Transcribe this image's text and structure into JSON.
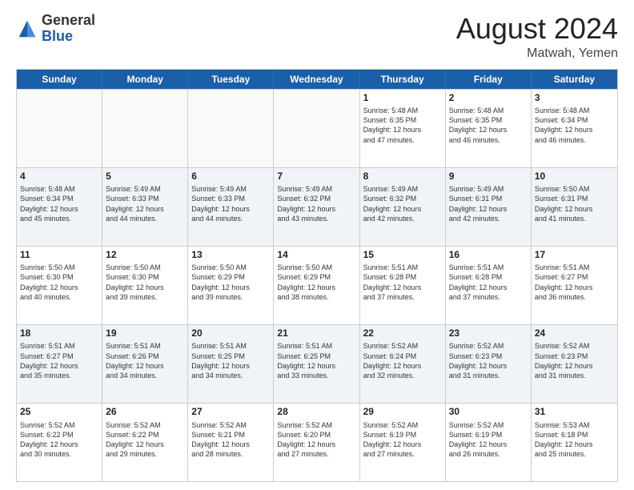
{
  "logo": {
    "general": "General",
    "blue": "Blue"
  },
  "header": {
    "title": "August 2024",
    "subtitle": "Matwah, Yemen"
  },
  "days": [
    "Sunday",
    "Monday",
    "Tuesday",
    "Wednesday",
    "Thursday",
    "Friday",
    "Saturday"
  ],
  "rows": [
    [
      {
        "day": "",
        "text": "",
        "empty": true
      },
      {
        "day": "",
        "text": "",
        "empty": true
      },
      {
        "day": "",
        "text": "",
        "empty": true
      },
      {
        "day": "",
        "text": "",
        "empty": true
      },
      {
        "day": "1",
        "text": "Sunrise: 5:48 AM\nSunset: 6:35 PM\nDaylight: 12 hours\nand 47 minutes.",
        "empty": false
      },
      {
        "day": "2",
        "text": "Sunrise: 5:48 AM\nSunset: 6:35 PM\nDaylight: 12 hours\nand 46 minutes.",
        "empty": false
      },
      {
        "day": "3",
        "text": "Sunrise: 5:48 AM\nSunset: 6:34 PM\nDaylight: 12 hours\nand 46 minutes.",
        "empty": false
      }
    ],
    [
      {
        "day": "4",
        "text": "Sunrise: 5:48 AM\nSunset: 6:34 PM\nDaylight: 12 hours\nand 45 minutes.",
        "empty": false
      },
      {
        "day": "5",
        "text": "Sunrise: 5:49 AM\nSunset: 6:33 PM\nDaylight: 12 hours\nand 44 minutes.",
        "empty": false
      },
      {
        "day": "6",
        "text": "Sunrise: 5:49 AM\nSunset: 6:33 PM\nDaylight: 12 hours\nand 44 minutes.",
        "empty": false
      },
      {
        "day": "7",
        "text": "Sunrise: 5:49 AM\nSunset: 6:32 PM\nDaylight: 12 hours\nand 43 minutes.",
        "empty": false
      },
      {
        "day": "8",
        "text": "Sunrise: 5:49 AM\nSunset: 6:32 PM\nDaylight: 12 hours\nand 42 minutes.",
        "empty": false
      },
      {
        "day": "9",
        "text": "Sunrise: 5:49 AM\nSunset: 6:31 PM\nDaylight: 12 hours\nand 42 minutes.",
        "empty": false
      },
      {
        "day": "10",
        "text": "Sunrise: 5:50 AM\nSunset: 6:31 PM\nDaylight: 12 hours\nand 41 minutes.",
        "empty": false
      }
    ],
    [
      {
        "day": "11",
        "text": "Sunrise: 5:50 AM\nSunset: 6:30 PM\nDaylight: 12 hours\nand 40 minutes.",
        "empty": false
      },
      {
        "day": "12",
        "text": "Sunrise: 5:50 AM\nSunset: 6:30 PM\nDaylight: 12 hours\nand 39 minutes.",
        "empty": false
      },
      {
        "day": "13",
        "text": "Sunrise: 5:50 AM\nSunset: 6:29 PM\nDaylight: 12 hours\nand 39 minutes.",
        "empty": false
      },
      {
        "day": "14",
        "text": "Sunrise: 5:50 AM\nSunset: 6:29 PM\nDaylight: 12 hours\nand 38 minutes.",
        "empty": false
      },
      {
        "day": "15",
        "text": "Sunrise: 5:51 AM\nSunset: 6:28 PM\nDaylight: 12 hours\nand 37 minutes.",
        "empty": false
      },
      {
        "day": "16",
        "text": "Sunrise: 5:51 AM\nSunset: 6:28 PM\nDaylight: 12 hours\nand 37 minutes.",
        "empty": false
      },
      {
        "day": "17",
        "text": "Sunrise: 5:51 AM\nSunset: 6:27 PM\nDaylight: 12 hours\nand 36 minutes.",
        "empty": false
      }
    ],
    [
      {
        "day": "18",
        "text": "Sunrise: 5:51 AM\nSunset: 6:27 PM\nDaylight: 12 hours\nand 35 minutes.",
        "empty": false
      },
      {
        "day": "19",
        "text": "Sunrise: 5:51 AM\nSunset: 6:26 PM\nDaylight: 12 hours\nand 34 minutes.",
        "empty": false
      },
      {
        "day": "20",
        "text": "Sunrise: 5:51 AM\nSunset: 6:25 PM\nDaylight: 12 hours\nand 34 minutes.",
        "empty": false
      },
      {
        "day": "21",
        "text": "Sunrise: 5:51 AM\nSunset: 6:25 PM\nDaylight: 12 hours\nand 33 minutes.",
        "empty": false
      },
      {
        "day": "22",
        "text": "Sunrise: 5:52 AM\nSunset: 6:24 PM\nDaylight: 12 hours\nand 32 minutes.",
        "empty": false
      },
      {
        "day": "23",
        "text": "Sunrise: 5:52 AM\nSunset: 6:23 PM\nDaylight: 12 hours\nand 31 minutes.",
        "empty": false
      },
      {
        "day": "24",
        "text": "Sunrise: 5:52 AM\nSunset: 6:23 PM\nDaylight: 12 hours\nand 31 minutes.",
        "empty": false
      }
    ],
    [
      {
        "day": "25",
        "text": "Sunrise: 5:52 AM\nSunset: 6:22 PM\nDaylight: 12 hours\nand 30 minutes.",
        "empty": false
      },
      {
        "day": "26",
        "text": "Sunrise: 5:52 AM\nSunset: 6:22 PM\nDaylight: 12 hours\nand 29 minutes.",
        "empty": false
      },
      {
        "day": "27",
        "text": "Sunrise: 5:52 AM\nSunset: 6:21 PM\nDaylight: 12 hours\nand 28 minutes.",
        "empty": false
      },
      {
        "day": "28",
        "text": "Sunrise: 5:52 AM\nSunset: 6:20 PM\nDaylight: 12 hours\nand 27 minutes.",
        "empty": false
      },
      {
        "day": "29",
        "text": "Sunrise: 5:52 AM\nSunset: 6:19 PM\nDaylight: 12 hours\nand 27 minutes.",
        "empty": false
      },
      {
        "day": "30",
        "text": "Sunrise: 5:52 AM\nSunset: 6:19 PM\nDaylight: 12 hours\nand 26 minutes.",
        "empty": false
      },
      {
        "day": "31",
        "text": "Sunrise: 5:53 AM\nSunset: 6:18 PM\nDaylight: 12 hours\nand 25 minutes.",
        "empty": false
      }
    ]
  ]
}
